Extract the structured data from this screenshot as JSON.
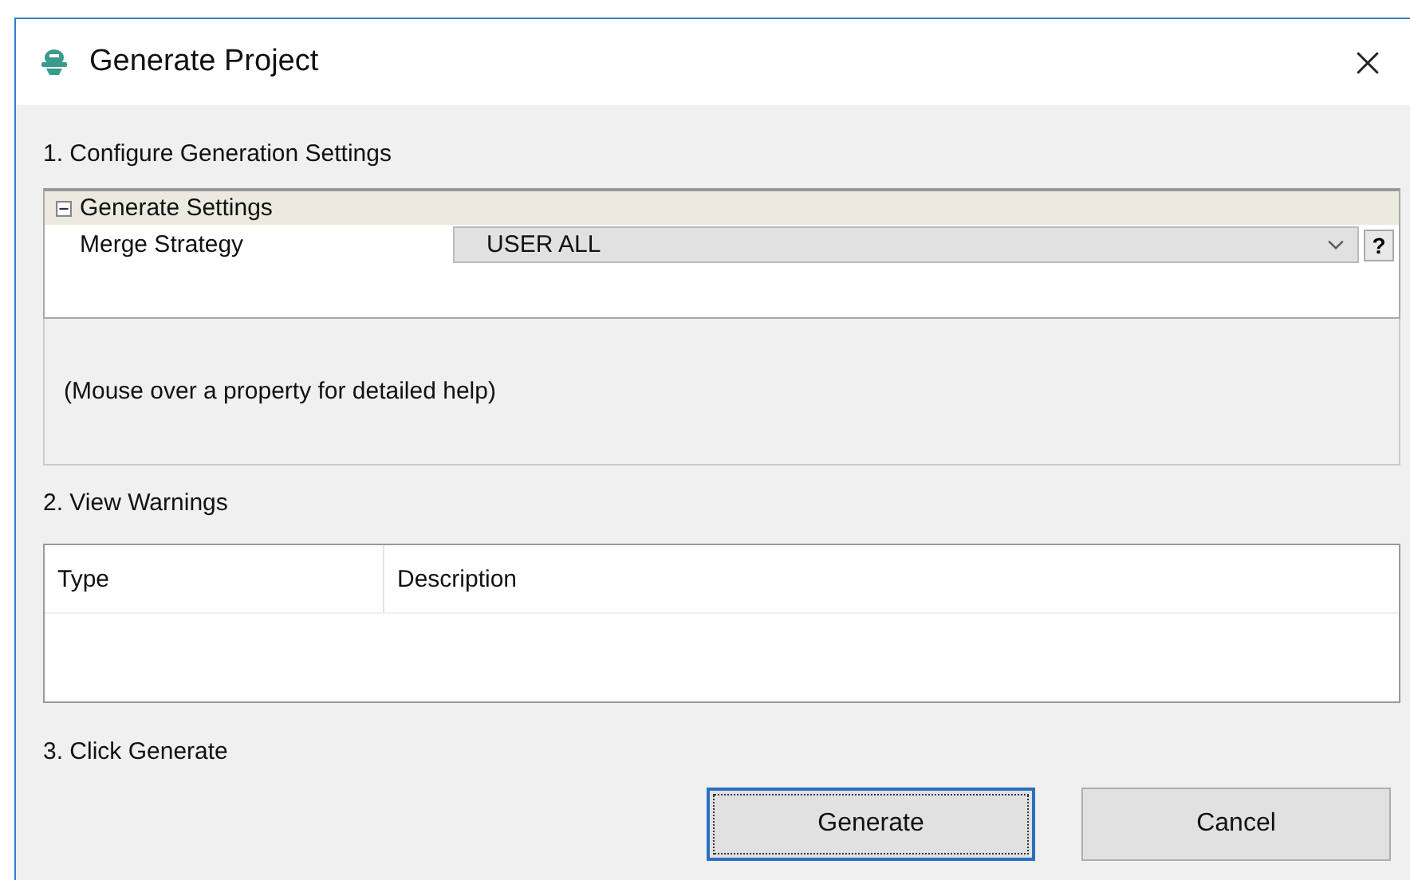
{
  "window": {
    "title": "Generate Project"
  },
  "sections": [
    "1. Configure Generation Settings",
    "2. View Warnings",
    "3. Click Generate"
  ],
  "property_grid": {
    "group": {
      "label": "Generate Settings",
      "expanded": true
    },
    "properties": [
      {
        "name": "Merge Strategy",
        "value": "USER ALL",
        "help_button": "?"
      }
    ],
    "help_text": "(Mouse over a property for detailed help)"
  },
  "warnings": {
    "columns": [
      "Type",
      "Description"
    ]
  },
  "buttons": [
    {
      "label": "Generate",
      "focused": true
    },
    {
      "label": "Cancel",
      "focused": false
    }
  ]
}
